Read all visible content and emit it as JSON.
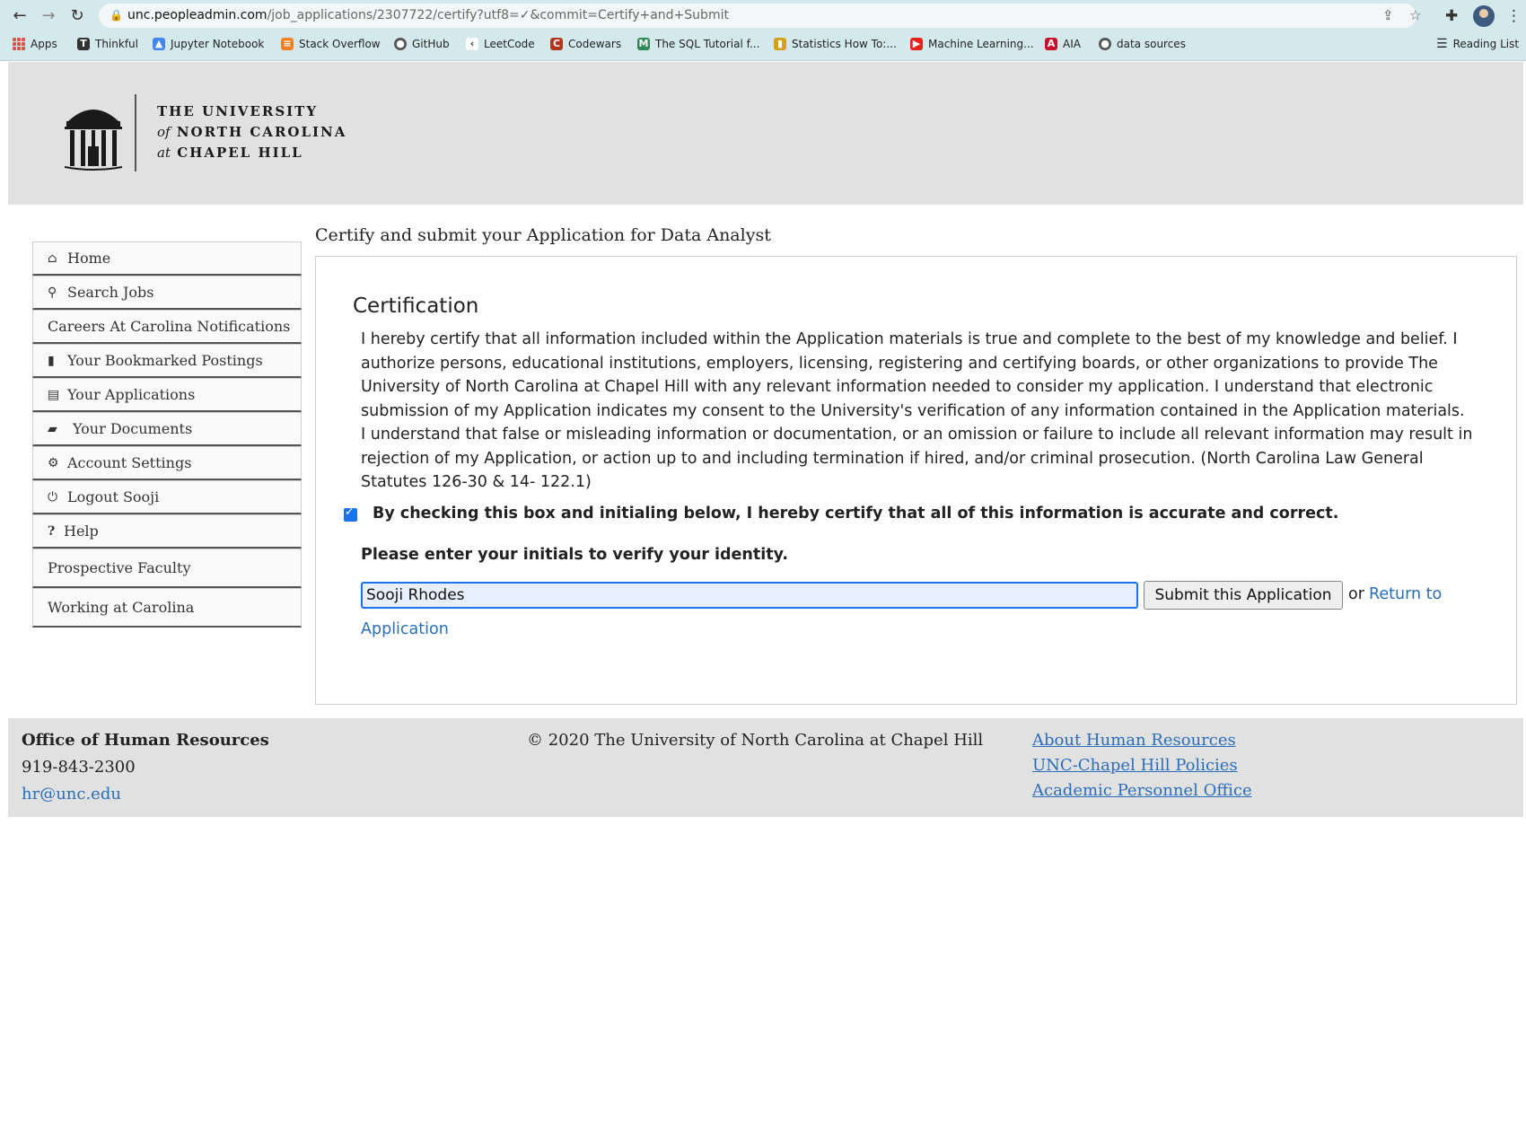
{
  "browser": {
    "url_host": "unc.peopleadmin.com",
    "url_path": "/job_applications/2307722/certify?utf8=✓&commit=Certify+and+Submit",
    "bookmarks": [
      {
        "label": "Apps"
      },
      {
        "label": "Thinkful"
      },
      {
        "label": "Jupyter Notebook"
      },
      {
        "label": "Stack Overflow"
      },
      {
        "label": "GitHub"
      },
      {
        "label": "LeetCode"
      },
      {
        "label": "Codewars"
      },
      {
        "label": "The SQL Tutorial f..."
      },
      {
        "label": "Statistics How To:..."
      },
      {
        "label": "Machine Learning..."
      },
      {
        "label": "AIA"
      },
      {
        "label": "data sources"
      }
    ],
    "reading_list": "Reading List"
  },
  "header": {
    "logo_line1": "THE UNIVERSITY",
    "logo_line2_prefix": "of",
    "logo_line2": "NORTH CAROLINA",
    "logo_line3_prefix": "at",
    "logo_line3": "CHAPEL HILL"
  },
  "sidebar": {
    "items": [
      {
        "label": "Home",
        "icon": "home-icon"
      },
      {
        "label": "Search Jobs",
        "icon": "search-icon"
      },
      {
        "label": "Careers At Carolina Notifications",
        "icon": ""
      },
      {
        "label": "Your Bookmarked Postings",
        "icon": "bookmark-icon"
      },
      {
        "label": "Your Applications",
        "icon": "document-icon"
      },
      {
        "label": "Your Documents",
        "icon": "folder-icon"
      },
      {
        "label": "Account Settings",
        "icon": "gear-icon"
      },
      {
        "label": "Logout Sooji",
        "icon": "power-icon"
      },
      {
        "label": "Help",
        "icon": "question-icon"
      },
      {
        "label": "Prospective Faculty",
        "icon": ""
      },
      {
        "label": "Working at Carolina",
        "icon": ""
      }
    ]
  },
  "main": {
    "heading": "Certify and submit your Application for Data Analyst",
    "cert_title": "Certification",
    "cert_text": "I hereby certify that all information included within the Application materials is true and complete to the best of my knowledge and belief. I authorize persons, educational institutions, employers, licensing, registering and certifying boards, or other organizations to provide The University of North Carolina at Chapel Hill with any relevant information needed to consider my application. I understand that electronic submission of my Application indicates my consent to the University's verification of any information contained in the Application materials. I understand that false or misleading information or documentation, or an omission or failure to include all relevant information may result in rejection of my Application, or action up to and including termination if hired, and/or criminal prosecution. (North Carolina Law General Statutes 126-30 & 14- 122.1)",
    "checkbox_label": "By checking this box and initialing below, I hereby certify that all of this information is accurate and correct.",
    "checkbox_checked": true,
    "initials_label": "Please enter your initials to verify your identity.",
    "initials_value": "Sooji Rhodes",
    "submit_label": "Submit this Application",
    "or_text": "or",
    "return_label_1": "Return to",
    "return_label_2": "Application"
  },
  "footer": {
    "office": "Office of Human Resources",
    "phone": "919-843-2300",
    "email": "hr@unc.edu",
    "copyright": "© 2020 The University of North Carolina at Chapel Hill",
    "links": [
      "About Human Resources",
      "UNC-Chapel Hill Policies",
      "Academic Personnel Office"
    ]
  },
  "colors": {
    "chrome_bg": "#d4e9ec",
    "banner_bg": "#e1e1e1",
    "link": "#2a6ebb",
    "focus": "#1a73e8"
  }
}
